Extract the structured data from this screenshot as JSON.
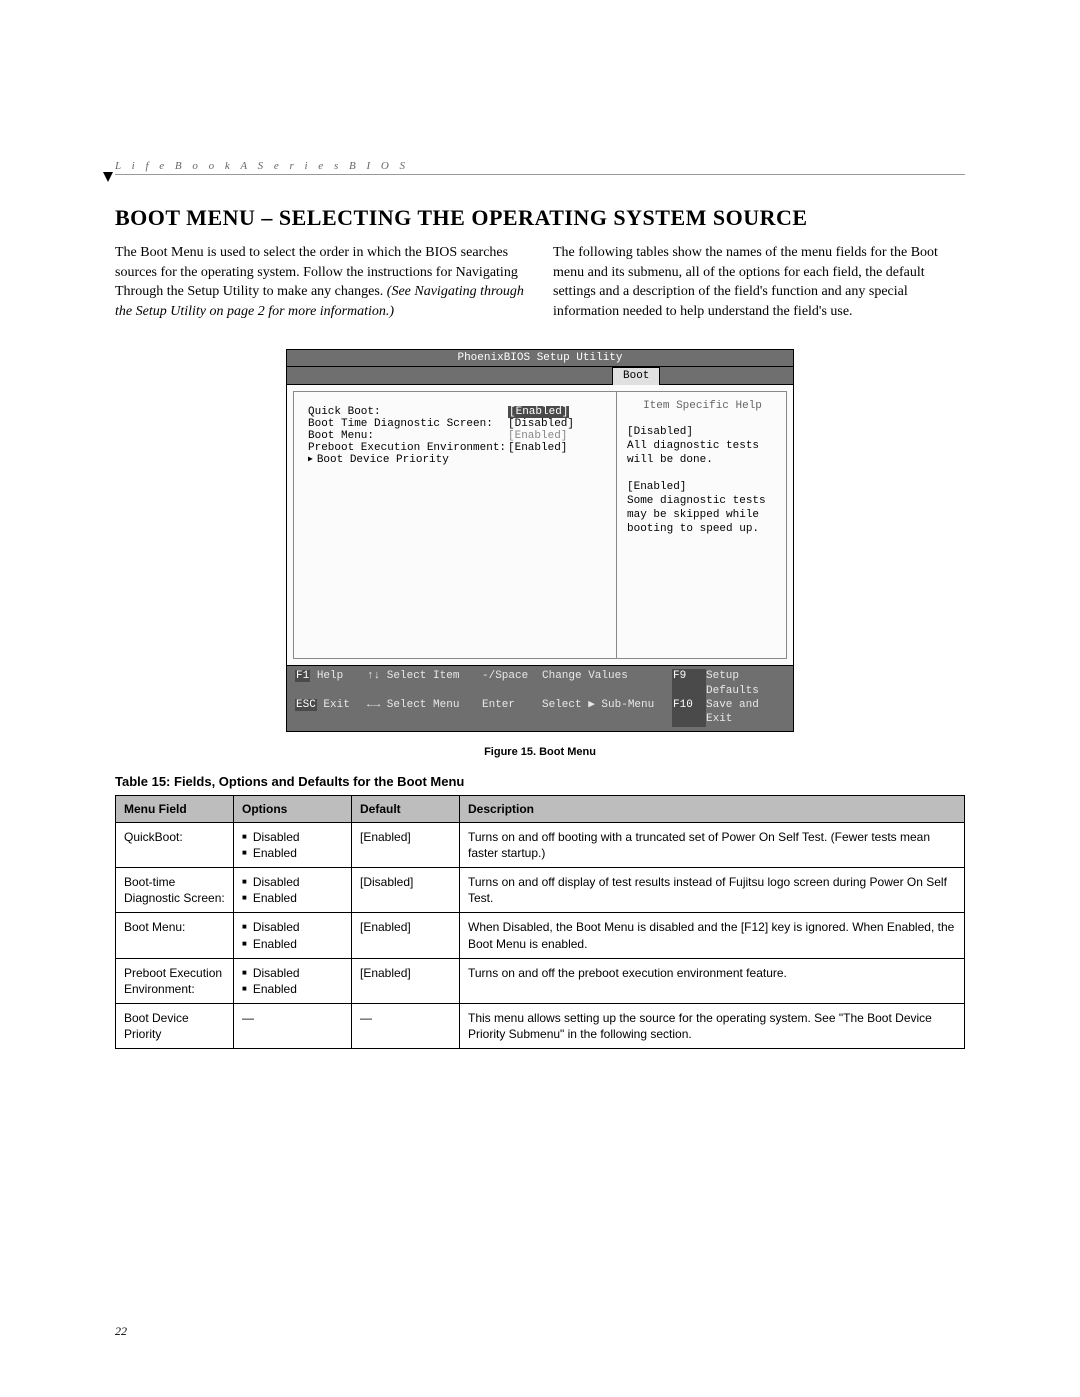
{
  "header": "L i f e B o o k   A   S e r i e s   B I O S",
  "title": "Boot Menu – Selecting the Operating System Source",
  "intro": {
    "left_a": "The Boot Menu is used to select the order in which the BIOS searches sources for the operating system. Follow the instructions for Navigating Through the Setup Utility to make any changes. ",
    "left_b": "(See Navigating through the Setup Utility on page 2 for more information.)",
    "right": "The following tables show the names of the menu fields for the Boot menu and its submenu, all of the options for each field, the default settings and a description of the field's function and any special information needed to help understand the field's use."
  },
  "bios": {
    "title": "PhoenixBIOS Setup Utility",
    "tab": "Boot",
    "rows": [
      {
        "label": "Quick Boot:",
        "value": "[Enabled]",
        "highlight": true
      },
      {
        "label": "Boot Time Diagnostic Screen:",
        "value": "[Disabled]"
      },
      {
        "label": "Boot Menu:",
        "value": "[Enabled]",
        "grey": true
      },
      {
        "label": "Preboot Execution Environment:",
        "value": "[Enabled]"
      },
      {
        "label": "Boot Device Priority",
        "submenu": true
      }
    ],
    "help_title": "Item Specific Help",
    "help_body": "[Disabled]\nAll diagnostic tests will be done.\n\n[Enabled]\nSome diagnostic tests may be skipped while booting to speed up.",
    "footer": {
      "f1": "F1",
      "f1l": "Help",
      "si": "↑↓ Select Item",
      "cv_k": "-/Space",
      "cv": "Change Values",
      "f9": "F9",
      "f9l": "Setup Defaults",
      "esc": "ESC",
      "escl": "Exit",
      "sm": "←→ Select Menu",
      "en_k": "Enter",
      "en": "Select ▶ Sub-Menu",
      "f10": "F10",
      "f10l": "Save and Exit"
    }
  },
  "figcap": "Figure 15.  Boot Menu",
  "tablecap": "Table 15: Fields, Options and Defaults for the Boot Menu",
  "table": {
    "headers": [
      "Menu Field",
      "Options",
      "Default",
      "Description"
    ],
    "rows": [
      {
        "field": "QuickBoot:",
        "options": [
          "Disabled",
          "Enabled"
        ],
        "default": "[Enabled]",
        "desc": "Turns on and off booting with a truncated set of Power On Self Test. (Fewer tests mean faster startup.)"
      },
      {
        "field": "Boot-time Diagnostic Screen:",
        "options": [
          "Disabled",
          "Enabled"
        ],
        "default": "[Disabled]",
        "desc": "Turns on and off display of test results instead of Fujitsu logo screen during Power On Self Test."
      },
      {
        "field": "Boot Menu:",
        "options": [
          "Disabled",
          "Enabled"
        ],
        "default": "[Enabled]",
        "desc": "When Disabled, the Boot Menu is disabled and the [F12] key is ignored. When Enabled, the Boot Menu is enabled."
      },
      {
        "field": "Preboot Execution Environment:",
        "options": [
          "Disabled",
          "Enabled"
        ],
        "default": "[Enabled]",
        "desc": "Turns on and off the preboot execution environment feature."
      },
      {
        "field": "Boot Device Priority",
        "options": [],
        "default": "—",
        "options_dash": "—",
        "desc": "This menu allows setting up the source for the operating system. See \"The Boot Device Priority Submenu\" in the following section."
      }
    ]
  },
  "page": "22"
}
